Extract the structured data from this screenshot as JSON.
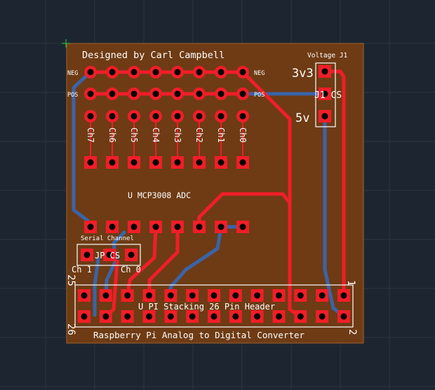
{
  "colors": {
    "canvas": "#1d2630",
    "board": "#6e3b14",
    "top_copper": "#f01e28",
    "bottom_copper": "#3a64a8",
    "silkscreen": "#ffffff",
    "origin_marker": "#2ecc40"
  },
  "labels": {
    "designer": "Designed by Carl Campbell",
    "voltage_header": "Voltage J1",
    "v33": "3v3",
    "v5": "5v",
    "j1_cs": "J1 CS",
    "neg_left": "NEG",
    "neg_right": "NEG",
    "pos_left": "POS",
    "pos_right": "POS",
    "channels": [
      "Ch7",
      "Ch6",
      "Ch5",
      "Ch4",
      "Ch3",
      "Ch2",
      "Ch1",
      "Ch0"
    ],
    "adc": "U MCP3008 ADC",
    "serial_channel": "Serial Channel",
    "jp_cs": "JP CS",
    "ch1": "Ch 1",
    "ch0": "Ch 0",
    "header": "U PI Stacking 26 Pin Header",
    "pin1": "1",
    "pin2": "2",
    "pin25": "25",
    "pin26": "26",
    "board_title": "Raspberry Pi Analog to Digital Converter"
  }
}
